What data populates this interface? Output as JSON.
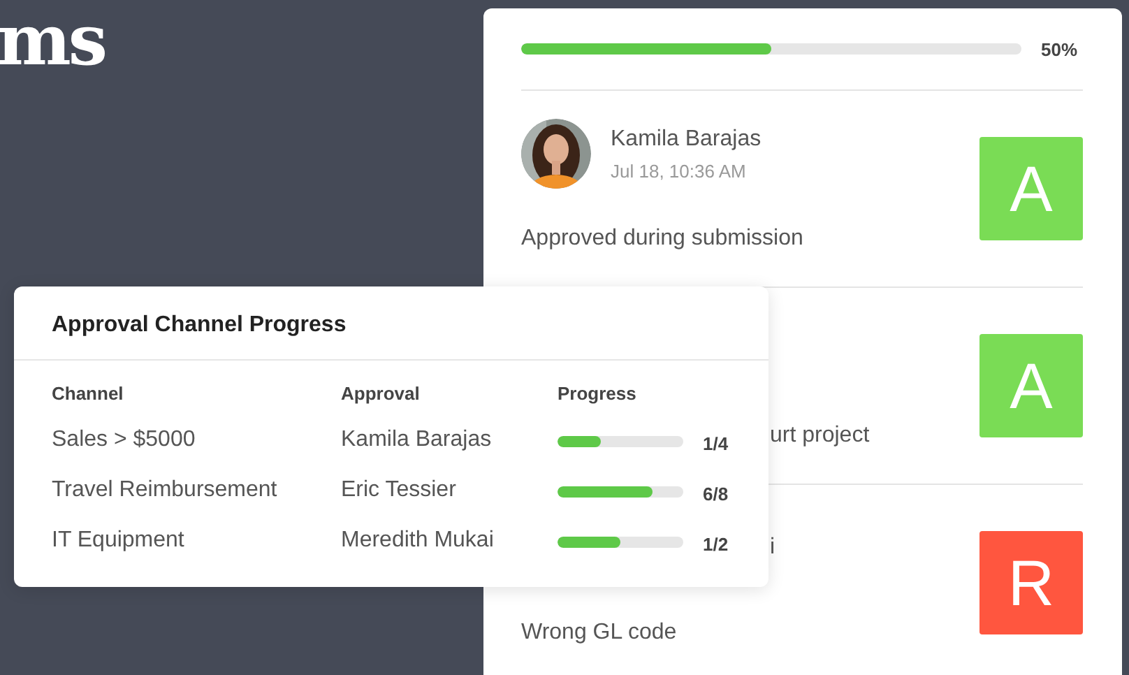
{
  "headline": "ms",
  "approval_card": {
    "progress": {
      "level": 0.5,
      "reading": "50%"
    },
    "entries": [
      {
        "name": "Kamila Barajas",
        "date": "Jul 18, 10:36 AM",
        "comment": "Approved during submission",
        "badge": {
          "letter": "A",
          "color": "#7adc55"
        }
      },
      {
        "comment": "urt project",
        "badge": {
          "letter": "A",
          "color": "#7adc55"
        }
      },
      {
        "name": "i",
        "comment": "Wrong GL code",
        "badge": {
          "letter": "R",
          "color": "#ff563f"
        }
      }
    ]
  },
  "progress_panel": {
    "title": "Approval Channel Progress",
    "columns": [
      "Channel",
      "Approval",
      "Progress"
    ],
    "rows": [
      {
        "channel": "Sales > $5000",
        "approval": "Kamila Barajas",
        "level": 0.34,
        "reading": "1/4"
      },
      {
        "channel": "Travel Reimbursement",
        "approval": "Eric Tessier",
        "level": 0.75,
        "reading": "6/8"
      },
      {
        "channel": "IT Equipment",
        "approval": "Meredith Mukai",
        "level": 0.5,
        "reading": "1/2"
      }
    ]
  }
}
